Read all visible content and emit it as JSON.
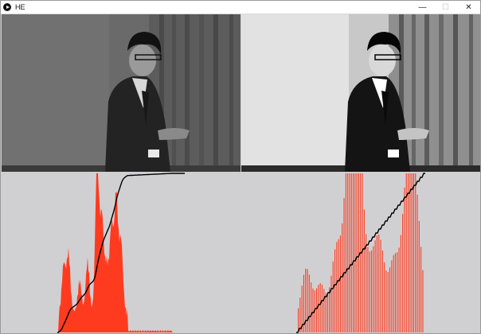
{
  "window": {
    "title": "HE"
  },
  "controls": {
    "minimize": "—",
    "maximize": "☐",
    "close": "✕"
  },
  "icons": {
    "app": "play-icon"
  },
  "colors": {
    "histogram": "#ff3b1f",
    "cdf": "#000000",
    "background": "#d0d0d3"
  }
}
